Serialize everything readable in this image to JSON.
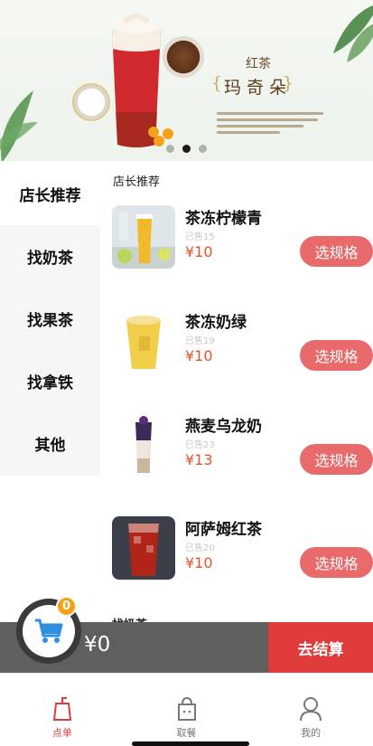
{
  "banner": {
    "title_sub": "红茶",
    "title_main": "玛奇朵",
    "slides": 3,
    "active_slide": 1
  },
  "sidebar": {
    "items": [
      {
        "label": "店长推荐",
        "active": true
      },
      {
        "label": "找奶茶",
        "active": false
      },
      {
        "label": "找果茶",
        "active": false
      },
      {
        "label": "找拿铁",
        "active": false
      },
      {
        "label": "其他",
        "active": false
      }
    ]
  },
  "main": {
    "section_title": "店长推荐",
    "products": [
      {
        "name": "茶冻柠檬青",
        "sold": "已售15",
        "price": "¥10",
        "button": "选规格"
      },
      {
        "name": "茶冻奶绿",
        "sold": "已售19",
        "price": "¥10",
        "button": "选规格"
      },
      {
        "name": "燕麦乌龙奶",
        "sold": "已售23",
        "price": "¥13",
        "button": "选规格"
      },
      {
        "name": "阿萨姆红茶",
        "sold": "已售20",
        "price": "¥10",
        "button": "选规格"
      }
    ],
    "next_section_peek": "找奶茶"
  },
  "cart": {
    "badge_count": "0",
    "total": "¥0",
    "checkout_label": "去结算"
  },
  "tabbar": {
    "tabs": [
      {
        "label": "点单",
        "icon": "order-icon",
        "active": true
      },
      {
        "label": "取餐",
        "icon": "bag-icon",
        "active": false
      },
      {
        "label": "我的",
        "icon": "user-icon",
        "active": false
      }
    ]
  },
  "colors": {
    "accent": "#e03c3c",
    "spec_button": "#e86a6a",
    "price": "#e8542a",
    "cart_bar": "#5f5f5f",
    "badge": "#f5a21b",
    "cart_icon": "#2f8fe0"
  }
}
